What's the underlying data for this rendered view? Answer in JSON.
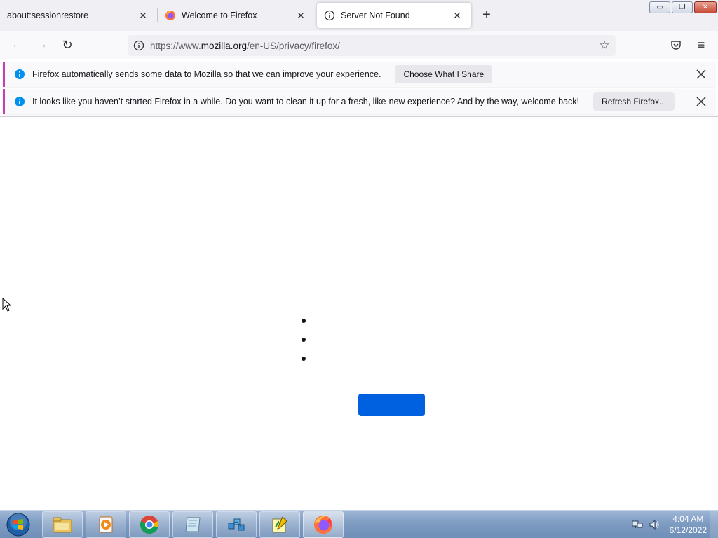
{
  "tabs": [
    {
      "title": "about:sessionrestore",
      "favicon": "none",
      "close": "✕"
    },
    {
      "title": "Welcome to Firefox",
      "favicon": "firefox-icon",
      "close": "✕"
    },
    {
      "title": "Server Not Found",
      "favicon": "info-icon",
      "close": "✕",
      "selected": true
    }
  ],
  "new_tab": "+",
  "window_buttons": {
    "minimize": "▭",
    "restore": "❐",
    "close": "✕"
  },
  "navbar": {
    "back": "←",
    "forward": "→",
    "reload": "↻",
    "url_prefix": "https://www.",
    "url_host": "mozilla.org",
    "url_path": "/en-US/privacy/firefox/",
    "bookmark": "☆",
    "menu": "≡"
  },
  "notifications": [
    {
      "message": "Firefox automatically sends some data to Mozilla so that we can improve your experience.",
      "button": "Choose What I Share"
    },
    {
      "message": "It looks like you haven’t started Firefox in a while. Do you want to clean it up for a fresh, like-new experience? And by the way, welcome back!",
      "button": "Refresh Firefox..."
    }
  ],
  "colors": {
    "accent": "#0061e0",
    "notice_border": "#c43fb4",
    "info_blue": "#0090ed"
  },
  "taskbar": {
    "apps": [
      "media-player-icon",
      "windows-explorer-icon",
      "chrome-icon",
      "notepad-icon",
      "network-app-icon",
      "sticky-editor-icon",
      "firefox-icon"
    ],
    "time": "4:04 AM",
    "date": "6/12/2022"
  }
}
